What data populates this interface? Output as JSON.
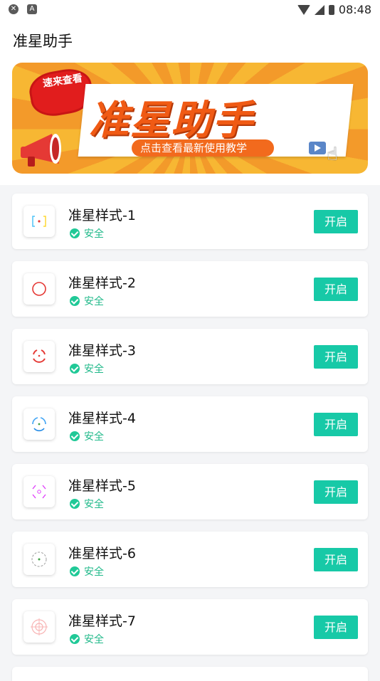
{
  "status_bar": {
    "time": "08:48"
  },
  "app": {
    "title": "准星助手"
  },
  "banner": {
    "badge": "速来查看",
    "title": "准星助手",
    "subtitle": "点击查看最新使用教学"
  },
  "items": [
    {
      "name": "准星样式-1",
      "status": "安全",
      "action": "开启",
      "icon": "crosshair-style-1-icon"
    },
    {
      "name": "准星样式-2",
      "status": "安全",
      "action": "开启",
      "icon": "crosshair-style-2-icon"
    },
    {
      "name": "准星样式-3",
      "status": "安全",
      "action": "开启",
      "icon": "crosshair-style-3-icon"
    },
    {
      "name": "准星样式-4",
      "status": "安全",
      "action": "开启",
      "icon": "crosshair-style-4-icon"
    },
    {
      "name": "准星样式-5",
      "status": "安全",
      "action": "开启",
      "icon": "crosshair-style-5-icon"
    },
    {
      "name": "准星样式-6",
      "status": "安全",
      "action": "开启",
      "icon": "crosshair-style-6-icon"
    },
    {
      "name": "准星样式-7",
      "status": "安全",
      "action": "开启",
      "icon": "crosshair-style-7-icon"
    }
  ],
  "colors": {
    "accent": "#17c9a7",
    "safe": "#20b98a",
    "banner_orange": "#f39a2a",
    "banner_red": "#e11d1d"
  }
}
